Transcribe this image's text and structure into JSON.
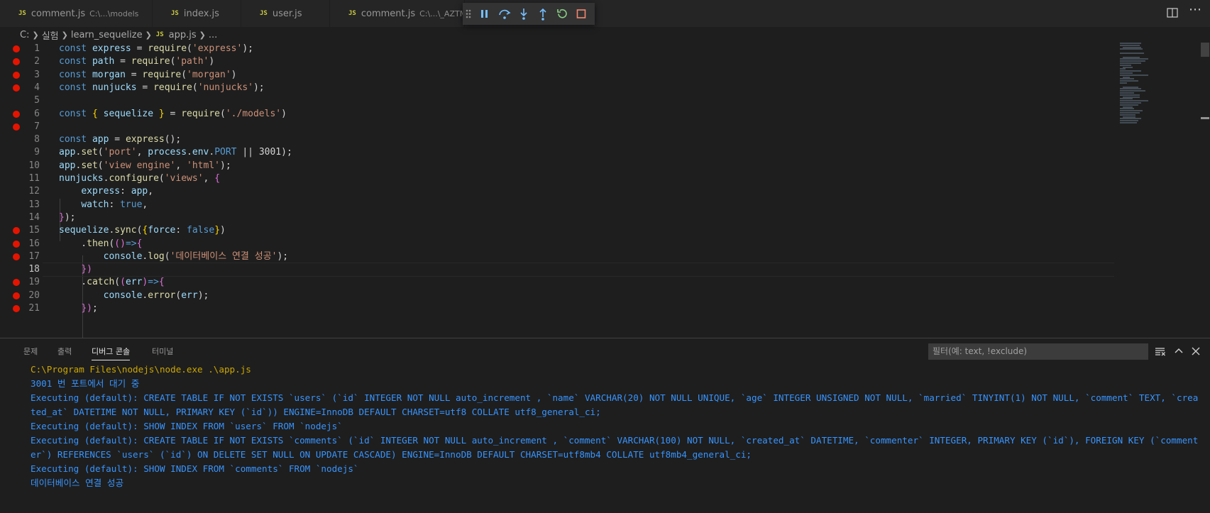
{
  "tabs": [
    {
      "label": "comment.js",
      "desc": "C:\\...\\models",
      "active": false
    },
    {
      "label": "index.js",
      "desc": "",
      "active": false
    },
    {
      "label": "user.js",
      "desc": "",
      "active": false
    },
    {
      "label": "comment.js",
      "desc": "C:\\...\\_AZTMPC",
      "active": false
    }
  ],
  "tab_badge": "JS",
  "breadcrumb": {
    "drive": "C:",
    "folder1": "실험",
    "folder2": "learn_sequelize",
    "file_badge": "JS",
    "file": "app.js",
    "more": "..."
  },
  "debug_toolbar": [
    "drag-handle",
    "pause",
    "step-over",
    "step-into",
    "step-out",
    "restart",
    "stop"
  ],
  "editor": {
    "current_line": 18,
    "line_numbers": [
      "1",
      "2",
      "3",
      "4",
      "5",
      "6",
      "7",
      "8",
      "9",
      "10",
      "11",
      "12",
      "13",
      "14",
      "15",
      "16",
      "17",
      "18",
      "19",
      "20",
      "21"
    ],
    "breakpoints": [
      1,
      2,
      3,
      4,
      6,
      7,
      15,
      16,
      17,
      19,
      20,
      21
    ],
    "lines": [
      [
        [
          "k",
          "const "
        ],
        [
          "v",
          "express"
        ],
        [
          "p",
          " = "
        ],
        [
          "f",
          "require"
        ],
        [
          "p",
          "("
        ],
        [
          "s",
          "'express'"
        ],
        [
          "p",
          ");"
        ]
      ],
      [
        [
          "k",
          "const "
        ],
        [
          "v",
          "path"
        ],
        [
          "p",
          " = "
        ],
        [
          "f",
          "require"
        ],
        [
          "p",
          "("
        ],
        [
          "s",
          "'path'"
        ],
        [
          "p",
          ")"
        ]
      ],
      [
        [
          "k",
          "const "
        ],
        [
          "v",
          "morgan"
        ],
        [
          "p",
          " = "
        ],
        [
          "f",
          "require"
        ],
        [
          "p",
          "("
        ],
        [
          "s",
          "'morgan'"
        ],
        [
          "p",
          ")"
        ]
      ],
      [
        [
          "k",
          "const "
        ],
        [
          "v",
          "nunjucks"
        ],
        [
          "p",
          " = "
        ],
        [
          "f",
          "require"
        ],
        [
          "p",
          "("
        ],
        [
          "s",
          "'nunjucks'"
        ],
        [
          "p",
          ");"
        ]
      ],
      [],
      [
        [
          "k",
          "const "
        ],
        [
          "b1",
          "{ "
        ],
        [
          "v",
          "sequelize"
        ],
        [
          "b1",
          " }"
        ],
        [
          "p",
          " = "
        ],
        [
          "f",
          "require"
        ],
        [
          "p",
          "("
        ],
        [
          "s",
          "'./models'"
        ],
        [
          "p",
          ")"
        ]
      ],
      [],
      [
        [
          "k",
          "const "
        ],
        [
          "v",
          "app"
        ],
        [
          "p",
          " = "
        ],
        [
          "f",
          "express"
        ],
        [
          "p",
          "();"
        ]
      ],
      [
        [
          "v",
          "app"
        ],
        [
          "p",
          "."
        ],
        [
          "f",
          "set"
        ],
        [
          "p",
          "("
        ],
        [
          "s",
          "'port'"
        ],
        [
          "p",
          ", "
        ],
        [
          "v",
          "process"
        ],
        [
          "p",
          "."
        ],
        [
          "v",
          "env"
        ],
        [
          "p",
          "."
        ],
        [
          "k",
          "PORT"
        ],
        [
          "p",
          " || "
        ],
        [
          "p",
          "3001"
        ],
        [
          "p",
          ");"
        ]
      ],
      [
        [
          "v",
          "app"
        ],
        [
          "p",
          "."
        ],
        [
          "f",
          "set"
        ],
        [
          "p",
          "("
        ],
        [
          "s",
          "'view engine'"
        ],
        [
          "p",
          ", "
        ],
        [
          "s",
          "'html'"
        ],
        [
          "p",
          ");"
        ]
      ],
      [
        [
          "v",
          "nunjucks"
        ],
        [
          "p",
          "."
        ],
        [
          "f",
          "configure"
        ],
        [
          "p",
          "("
        ],
        [
          "s",
          "'views'"
        ],
        [
          "p",
          ", "
        ],
        [
          "b2",
          "{"
        ]
      ],
      [
        [
          "p",
          "    "
        ],
        [
          "v",
          "express"
        ],
        [
          "p",
          ": "
        ],
        [
          "v",
          "app"
        ],
        [
          "p",
          ","
        ]
      ],
      [
        [
          "p",
          "    "
        ],
        [
          "v",
          "watch"
        ],
        [
          "p",
          ": "
        ],
        [
          "k",
          "true"
        ],
        [
          "p",
          ","
        ]
      ],
      [
        [
          "b2",
          "}"
        ],
        [
          "p",
          ");"
        ]
      ],
      [
        [
          "v",
          "sequelize"
        ],
        [
          "p",
          "."
        ],
        [
          "f",
          "sync"
        ],
        [
          "p",
          "("
        ],
        [
          "b1",
          "{"
        ],
        [
          "v",
          "force"
        ],
        [
          "p",
          ": "
        ],
        [
          "k",
          "false"
        ],
        [
          "b1",
          "}"
        ],
        [
          "p",
          ")"
        ]
      ],
      [
        [
          "p",
          "    ."
        ],
        [
          "f",
          "then"
        ],
        [
          "p",
          "("
        ],
        [
          "b2",
          "()"
        ],
        [
          "k",
          "=>"
        ],
        [
          "b2",
          "{"
        ]
      ],
      [
        [
          "p",
          "        "
        ],
        [
          "v",
          "console"
        ],
        [
          "p",
          "."
        ],
        [
          "f",
          "log"
        ],
        [
          "p",
          "("
        ],
        [
          "s",
          "'데이터베이스 연결 성공'"
        ],
        [
          "p",
          ");"
        ]
      ],
      [
        [
          "p",
          "    "
        ],
        [
          "b2",
          "})"
        ]
      ],
      [
        [
          "p",
          "    ."
        ],
        [
          "f",
          "catch"
        ],
        [
          "p",
          "("
        ],
        [
          "b2",
          "("
        ],
        [
          "v",
          "err"
        ],
        [
          "b2",
          ")"
        ],
        [
          "k",
          "=>"
        ],
        [
          "b2",
          "{"
        ]
      ],
      [
        [
          "p",
          "        "
        ],
        [
          "v",
          "console"
        ],
        [
          "p",
          "."
        ],
        [
          "f",
          "error"
        ],
        [
          "p",
          "("
        ],
        [
          "v",
          "err"
        ],
        [
          "p",
          ");"
        ]
      ],
      [
        [
          "p",
          "    "
        ],
        [
          "b2",
          "})"
        ],
        [
          "p",
          ";"
        ]
      ]
    ]
  },
  "panel": {
    "tabs": [
      {
        "label": "문제",
        "active": false
      },
      {
        "label": "출력",
        "active": false
      },
      {
        "label": "디버그 콘솔",
        "active": true
      },
      {
        "label": "터미널",
        "active": false
      }
    ],
    "filter_placeholder": "필터(예: text, !exclude)",
    "output": [
      {
        "style": "y",
        "text": "C:\\Program Files\\nodejs\\node.exe .\\app.js"
      },
      {
        "style": "g",
        "text": "3001 번 포트에서 대기 중"
      },
      {
        "style": "g",
        "text": "Executing (default): CREATE TABLE IF NOT EXISTS `users` (`id` INTEGER NOT NULL auto_increment , `name` VARCHAR(20) NOT NULL UNIQUE, `age` INTEGER UNSIGNED NOT NULL, `married` TINYINT(1) NOT NULL, `comment` TEXT, `created_at` DATETIME NOT NULL, PRIMARY KEY (`id`)) ENGINE=InnoDB DEFAULT CHARSET=utf8 COLLATE utf8_general_ci;"
      },
      {
        "style": "g",
        "text": "Executing (default): SHOW INDEX FROM `users` FROM `nodejs`"
      },
      {
        "style": "g",
        "text": "Executing (default): CREATE TABLE IF NOT EXISTS `comments` (`id` INTEGER NOT NULL auto_increment , `comment` VARCHAR(100) NOT NULL, `created_at` DATETIME, `commenter` INTEGER, PRIMARY KEY (`id`), FOREIGN KEY (`commenter`) REFERENCES `users` (`id`) ON DELETE SET NULL ON UPDATE CASCADE) ENGINE=InnoDB DEFAULT CHARSET=utf8mb4 COLLATE utf8mb4_general_ci;"
      },
      {
        "style": "g",
        "text": "Executing (default): SHOW INDEX FROM `comments` FROM `nodejs`"
      },
      {
        "style": "g",
        "text": "데이터베이스 연결 성공"
      }
    ]
  },
  "colors": {
    "breakpoint": "#e51400",
    "console_text": "#3794ff",
    "console_cmd": "#cca700"
  }
}
